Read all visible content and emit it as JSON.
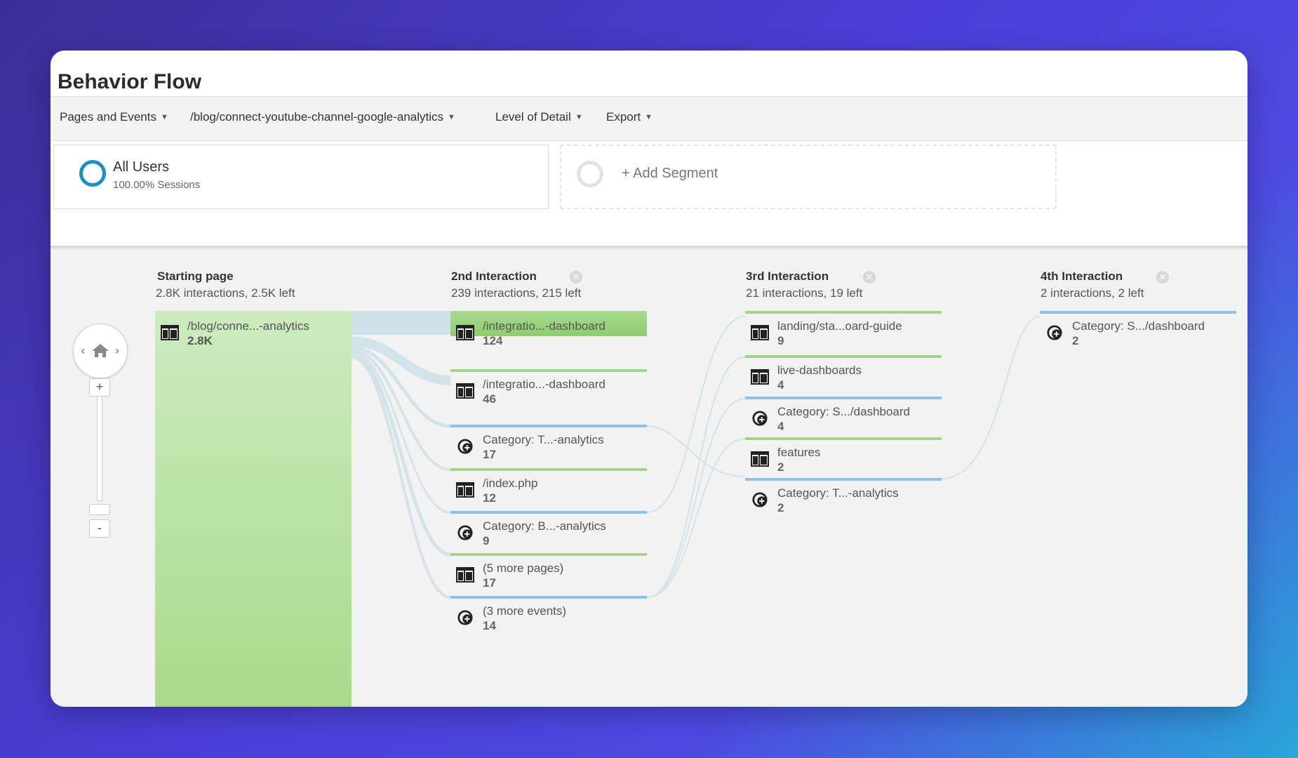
{
  "title": "Behavior Flow",
  "toolbar": {
    "pages_events": "Pages and Events",
    "path": "/blog/connect-youtube-channel-google-analytics",
    "level_of_detail": "Level of Detail",
    "export": "Export"
  },
  "segments": {
    "all_users": {
      "name": "All Users",
      "detail": "100.00% Sessions"
    },
    "add": "+ Add Segment"
  },
  "colors": {
    "green": "#a4d48a",
    "blue": "#8fc1e6",
    "ring": "#1d8fbf"
  },
  "columns": [
    {
      "title": "Starting page",
      "sub": "2.8K interactions, 2.5K left"
    },
    {
      "title": "2nd Interaction",
      "sub": "239 interactions, 215 left"
    },
    {
      "title": "3rd Interaction",
      "sub": "21 interactions, 19 left"
    },
    {
      "title": "4th Interaction",
      "sub": "2 interactions, 2 left"
    }
  ],
  "start": {
    "label": "/blog/conne...-analytics",
    "count": "2.8K",
    "icon": "page-icon"
  },
  "col2": [
    {
      "label": "/integratio...-dashboard",
      "count": "124",
      "icon": "page-icon",
      "bar": "big"
    },
    {
      "label": "/integratio...-dashboard",
      "count": "46",
      "icon": "page-icon",
      "bar": "green"
    },
    {
      "label": "Category: T...-analytics",
      "count": "17",
      "icon": "event-icon",
      "bar": "blue"
    },
    {
      "label": "/index.php",
      "count": "12",
      "icon": "page-icon",
      "bar": "green"
    },
    {
      "label": "Category: B...-analytics",
      "count": "9",
      "icon": "event-icon",
      "bar": "blue"
    },
    {
      "label": "(5 more pages)",
      "count": "17",
      "icon": "page-icon",
      "bar": "green"
    },
    {
      "label": "(3 more events)",
      "count": "14",
      "icon": "event-icon",
      "bar": "blue"
    }
  ],
  "col3": [
    {
      "label": "landing/sta...oard-guide",
      "count": "9",
      "icon": "page-icon",
      "bar": "green"
    },
    {
      "label": "live-dashboards",
      "count": "4",
      "icon": "page-icon",
      "bar": "green"
    },
    {
      "label": "Category: S.../dashboard",
      "count": "4",
      "icon": "event-icon",
      "bar": "blue"
    },
    {
      "label": "features",
      "count": "2",
      "icon": "page-icon",
      "bar": "green"
    },
    {
      "label": "Category: T...-analytics",
      "count": "2",
      "icon": "event-icon",
      "bar": "blue"
    }
  ],
  "col4": [
    {
      "label": "Category: S.../dashboard",
      "count": "2",
      "icon": "event-icon",
      "bar": "blue"
    }
  ],
  "zoom": {
    "in": "+",
    "out": "-"
  }
}
